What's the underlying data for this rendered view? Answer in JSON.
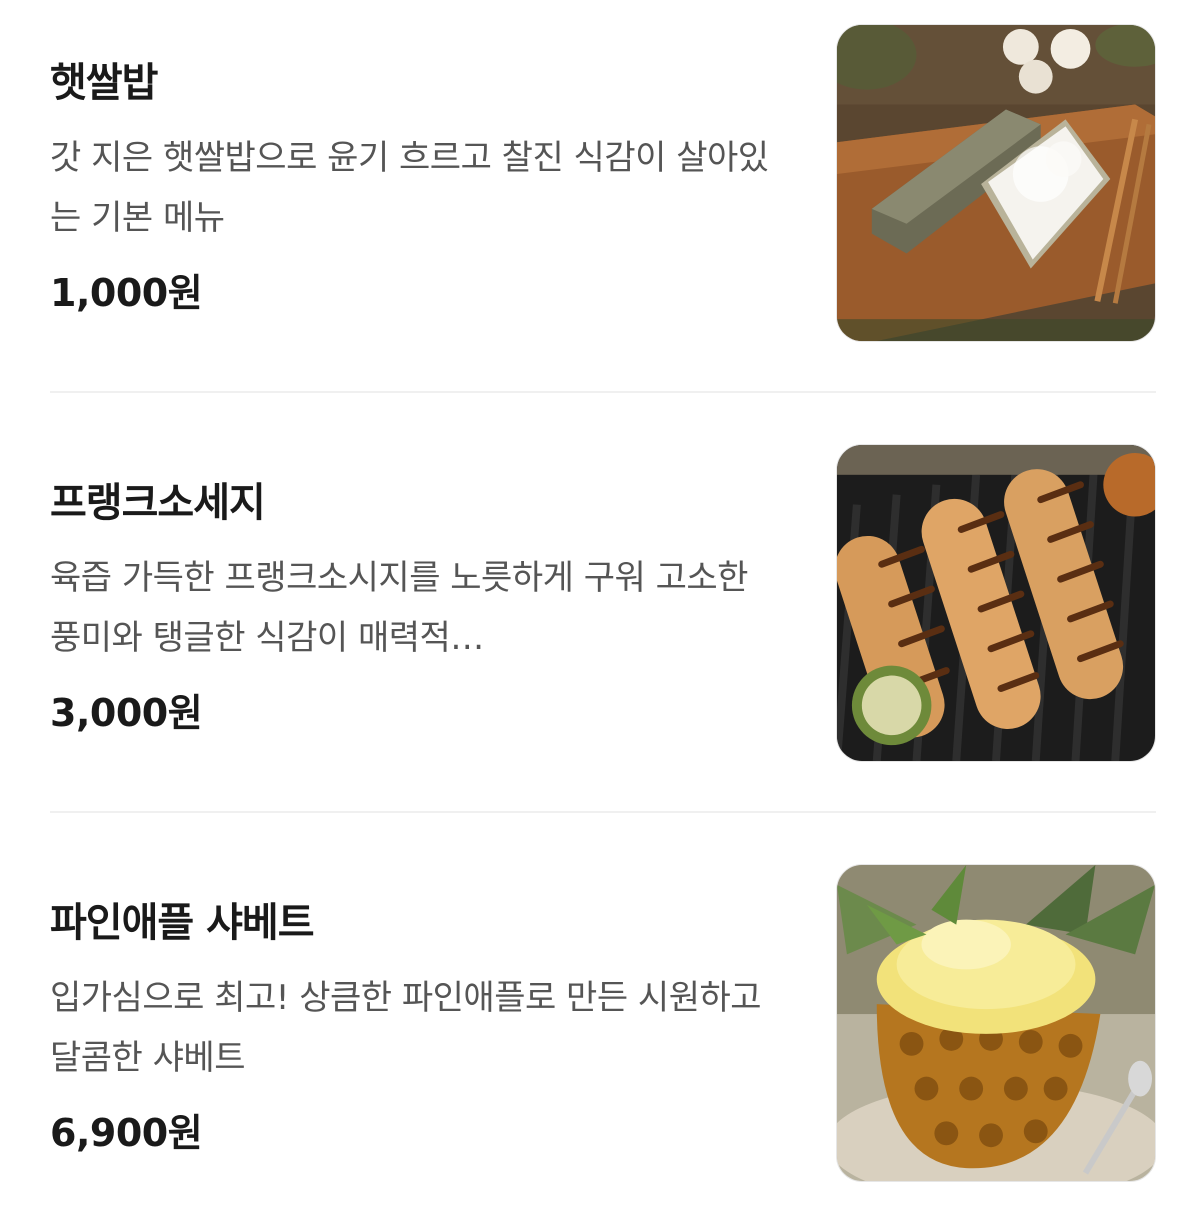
{
  "menu": {
    "items": [
      {
        "name": "햇쌀밥",
        "description": "갓 지은 햇쌀밥으로 윤기 흐르고 찰진 식감이 살아있는 기본 메뉴",
        "price": "1,000원",
        "image_icon": "rice-in-tin-box-photo"
      },
      {
        "name": "프랭크소세지",
        "description": "육즙 가득한 프랭크소시지를 노릇하게 구워 고소한 풍미와 탱글한 식감이 매력적…",
        "price": "3,000원",
        "image_icon": "grilled-sausages-photo"
      },
      {
        "name": "파인애플 샤베트",
        "description": "입가심으로 최고! 상큼한 파인애플로 만든 시원하고 달콤한 샤베트",
        "price": "6,900원",
        "image_icon": "pineapple-sherbet-photo"
      }
    ]
  }
}
